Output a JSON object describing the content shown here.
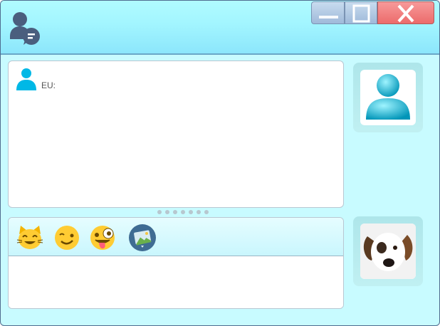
{
  "chat": {
    "sender_label": "EU:"
  },
  "composer": {
    "emojis": [
      "cat-face",
      "winking-face",
      "zany-face",
      "image-picker"
    ]
  },
  "icons": {
    "app": "chat-user-icon",
    "minimize": "minimize-icon",
    "maximize": "maximize-icon",
    "close": "close-icon",
    "sender": "user-icon"
  },
  "colors": {
    "titlebar": "#a2f5ff",
    "window_bg": "#c8fbff",
    "close_button": "#ec6b6b",
    "accent": "#00b8e6"
  }
}
